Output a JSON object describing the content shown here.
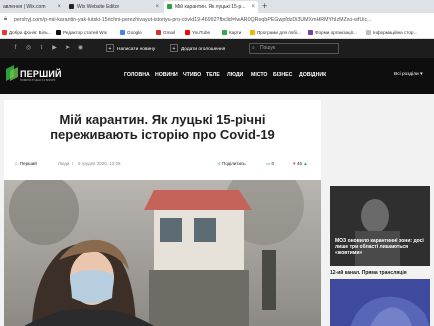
{
  "browser": {
    "tabs": [
      {
        "label": "авлення | Wix.com",
        "active": false
      },
      {
        "label": "Wix Website Editor",
        "active": false
      },
      {
        "label": "Мій карантин. Як луцькі 15-р...",
        "active": true
      }
    ],
    "url": "pershyj.com/p-mii-karantin-yak-lutski-15richni-perezhivayut-istoriyu-pro-covid19-46992?fbclid=IwAR0QReqbPEGwpfdzDi3UMXmHRMYhIzMZxo-wfUic...",
    "bookmarks": [
      "Добра фонія: Біль...",
      "Редактор статей Wix",
      "Google",
      "Gmail",
      "YouTube",
      "Карти",
      "Програми для побі...",
      "Форми організації...",
      "Інформаційна стор..."
    ]
  },
  "site": {
    "topbar": {
      "write_news": "Написати новину",
      "add_announcement": "Додати оголошення",
      "search_placeholder": "Пошук"
    },
    "logo": {
      "name": "ПЕРШИЙ",
      "tagline": "НОВИНИ ЛУЦЬКА ТА ВОЛИНІ"
    },
    "nav": [
      "ГОЛОВНА",
      "НОВИНИ",
      "ЧТИВО",
      "ТЕЛЕ",
      "ЛЮДИ",
      "МІСТО",
      "БІЗНЕС",
      "ДОВІДНИК"
    ],
    "all_sections": "Всі розділи"
  },
  "article": {
    "title": "Мій карантин. Як луцькі 15-річні переживають історію про Covid-19",
    "author": "Перший",
    "category": "Люди",
    "date": "5 грудня 2020, 12:09",
    "share_label": "Поділитись",
    "comments": "0",
    "likes": "45"
  },
  "sidebar": {
    "news_headline": "МОЗ оновило карантинні зони: досі лише три області лишаються «жовтими»",
    "live_title": "12-ий канал. Пряма трансляція"
  },
  "colors": {
    "accent_green": "#2e9e3e",
    "dark_bar": "#1d1d1d",
    "nav_bg": "#0e0e0e"
  }
}
